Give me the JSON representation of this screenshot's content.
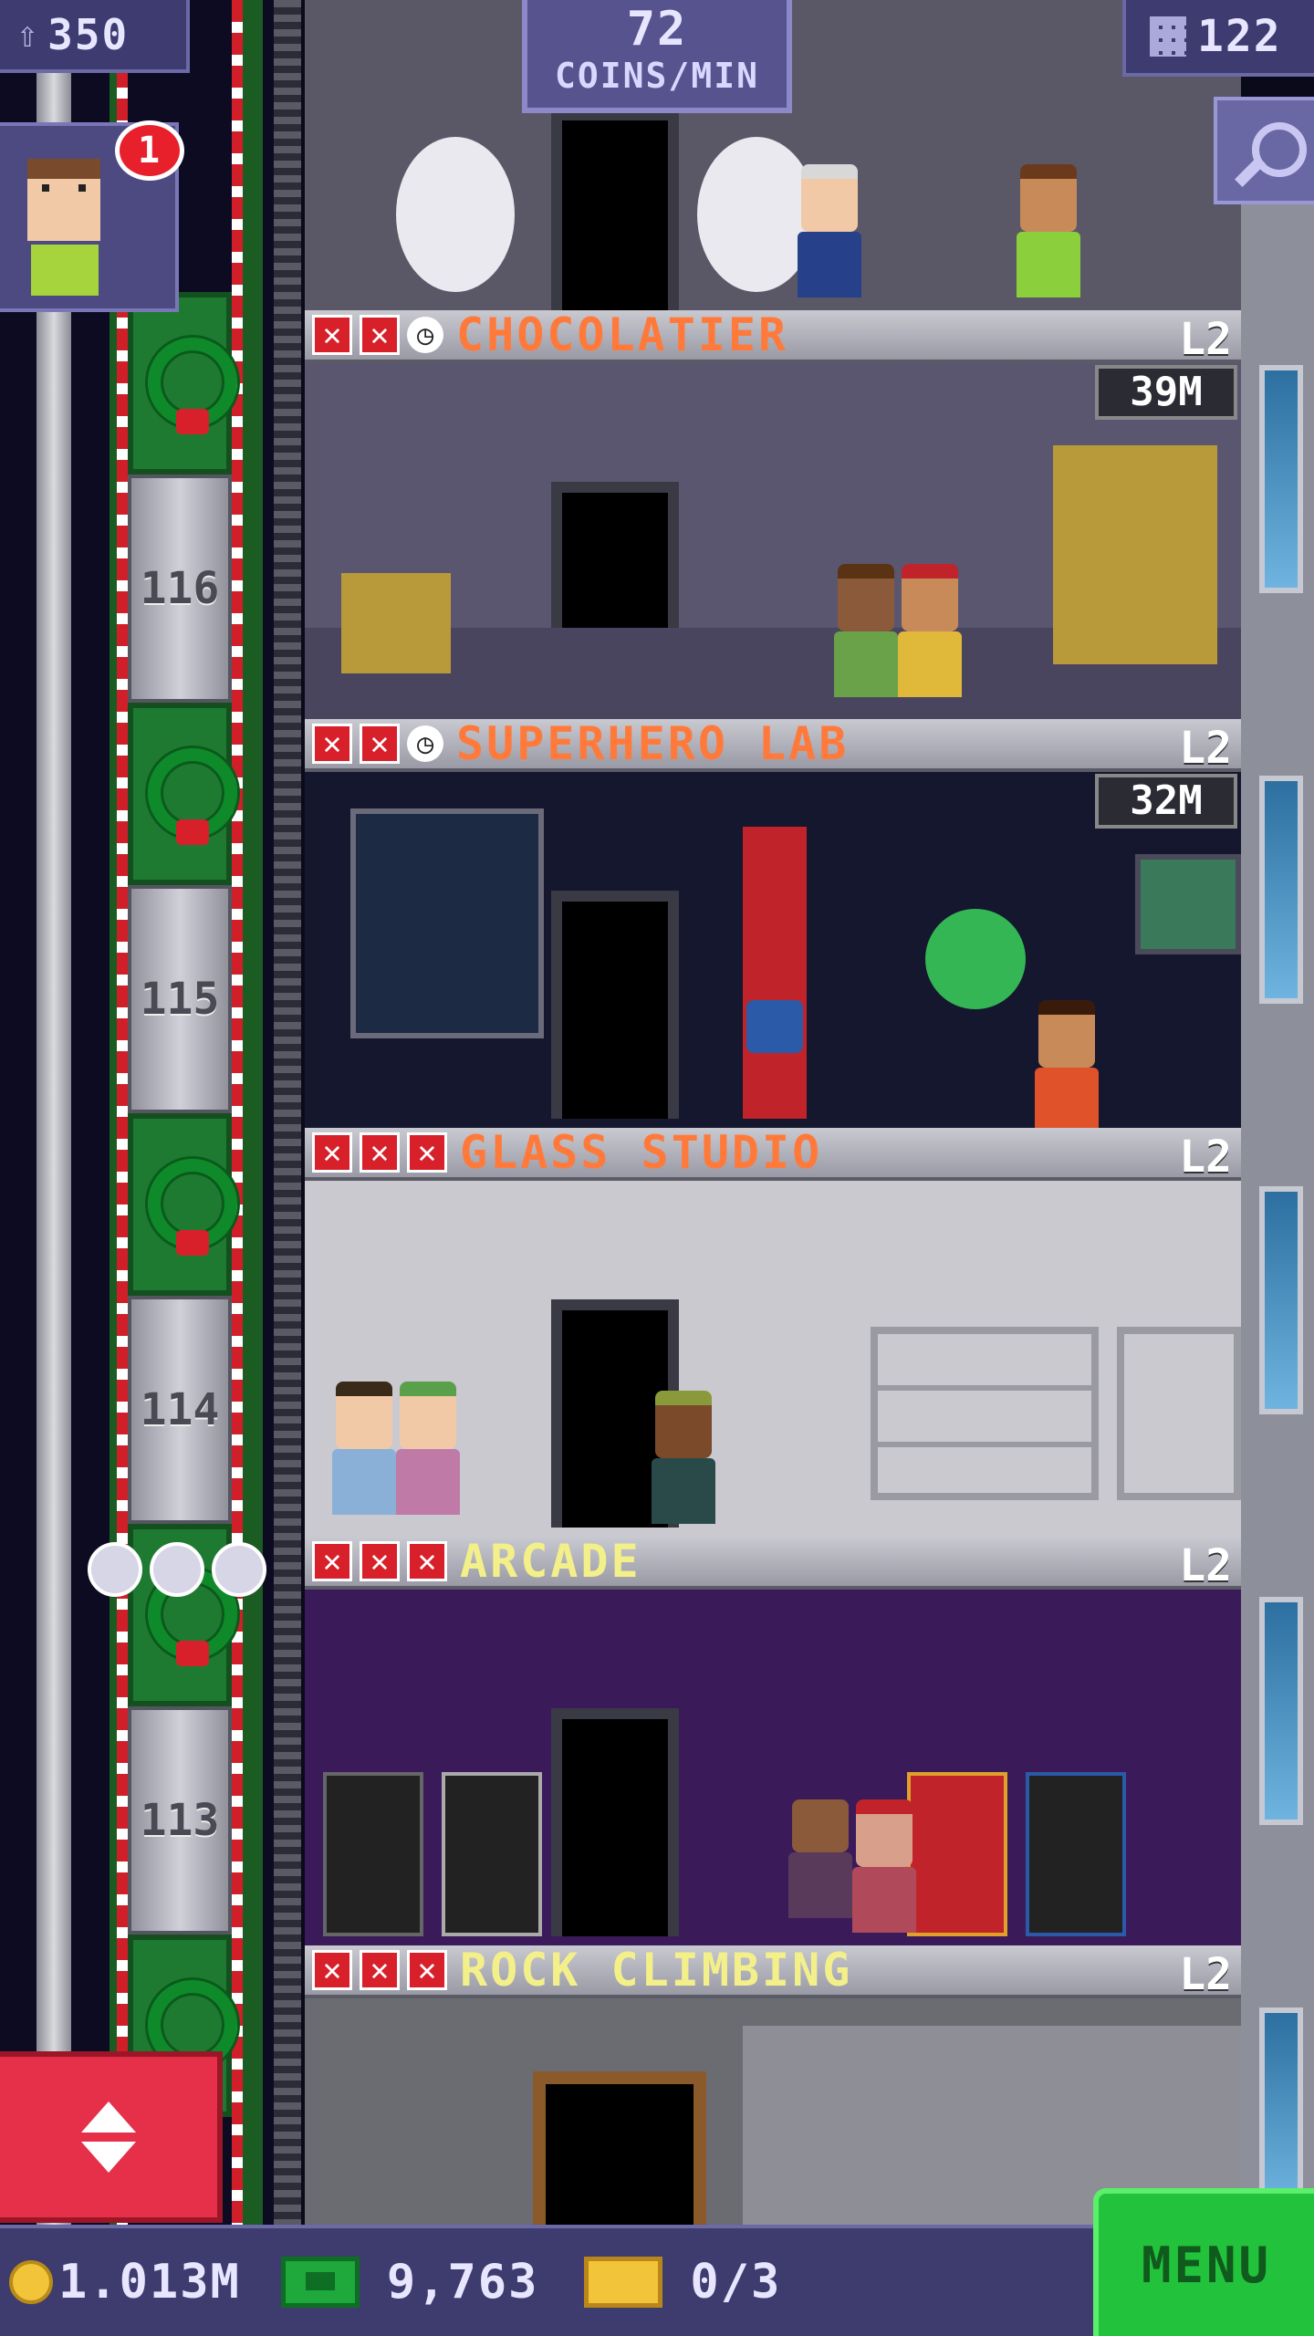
{
  "hud": {
    "population": "350",
    "coins_per_min_value": "72",
    "coins_per_min_label": "COINS/MIN",
    "floor_count": "122",
    "notification_count": "1"
  },
  "shaft_floors": [
    "116",
    "115",
    "114",
    "113"
  ],
  "floors": [
    {
      "name": "CHOCOLATIER",
      "level": "L2",
      "stock": [
        "x",
        "x",
        "clock"
      ],
      "timer": "39M",
      "name_color": "#ff7a3a",
      "wall_color": "#5b5670"
    },
    {
      "name": "SUPERHERO LAB",
      "level": "L2",
      "stock": [
        "x",
        "x",
        "clock"
      ],
      "timer": "32M",
      "name_color": "#ff7a3a",
      "wall_color": "#14172e"
    },
    {
      "name": "GLASS STUDIO",
      "level": "L2",
      "stock": [
        "x",
        "x",
        "x"
      ],
      "timer": "",
      "name_color": "#ff7a3a",
      "wall_color": "#c9c9cf"
    },
    {
      "name": "ARCADE",
      "level": "L2",
      "stock": [
        "x",
        "x",
        "x"
      ],
      "timer": "",
      "name_color": "#f3f08a",
      "wall_color": "#3b1a5a"
    },
    {
      "name": "ROCK CLIMBING",
      "level": "L2",
      "stock": [
        "x",
        "x",
        "x"
      ],
      "timer": "",
      "name_color": "#f3f08a",
      "wall_color": "#6b6b72"
    }
  ],
  "bottom": {
    "coins": "1.013M",
    "bux": "9,763",
    "tickets": "0/3",
    "menu_label": "MENU"
  },
  "icons": {
    "population": "person-up-icon",
    "floors": "building-grid-icon",
    "search": "magnifier-icon",
    "coin": "coin-icon",
    "bux": "banknote-icon",
    "ticket": "golden-ticket-icon",
    "elevator": "up-down-arrows-icon",
    "stock_empty": "red-x-icon",
    "restocking": "clock-icon",
    "rating": "star-icon"
  }
}
